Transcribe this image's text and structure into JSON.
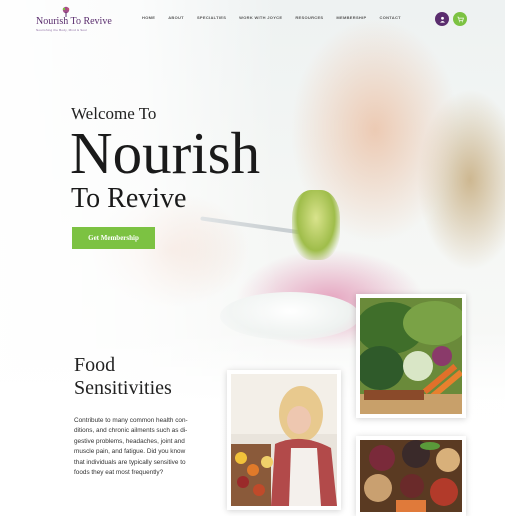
{
  "header": {
    "logo_text": "Nourish To Revive",
    "logo_tagline": "Nourishing the Body, Mind & Soul",
    "nav": [
      "HOME",
      "ABOUT",
      "SPECIALTIES",
      "WORK WITH JOYCE",
      "RESOURCES",
      "MEMBERSHIP",
      "CONTACT"
    ],
    "account_icon": "account-icon",
    "cart_icon": "cart-icon"
  },
  "hero": {
    "welcome": "Welcome To",
    "title": "Nourish",
    "subtitle": "To Revive",
    "cta_label": "Get Membership"
  },
  "section": {
    "title_line1": "Food",
    "title_line2": "Sensitivities",
    "body_lines": [
      "Contribute to many common health con-",
      "ditions, and chronic ailments such as di-",
      "gestive problems, headaches, joint and",
      "muscle pain, and fatigue.  Did you know",
      "that individuals are typically sensitive to",
      "foods they eat most frequently?"
    ]
  },
  "colors": {
    "brand_purple": "#5a2d6e",
    "accent_green": "#7cc242"
  }
}
